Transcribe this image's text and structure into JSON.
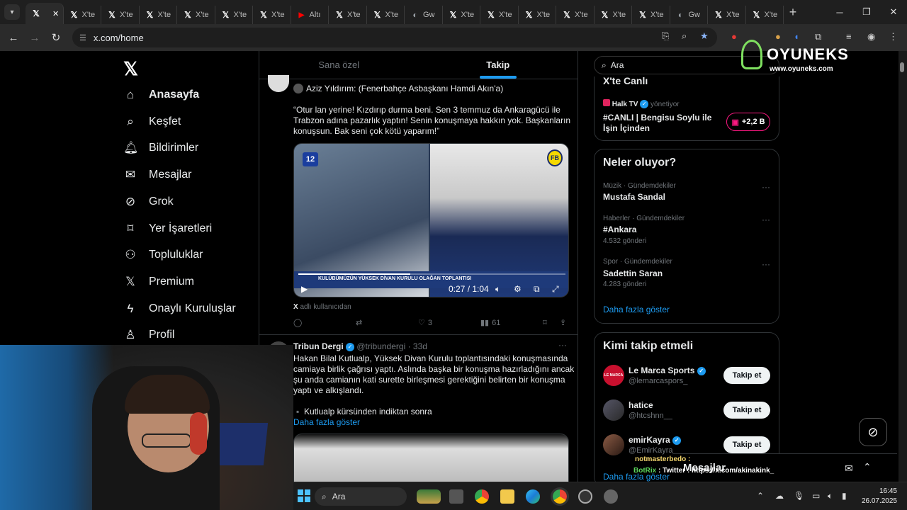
{
  "browser": {
    "tabs": [
      {
        "icon": "X",
        "label": ""
      },
      {
        "icon": "X",
        "label": "X'te"
      },
      {
        "icon": "X",
        "label": "X'te"
      },
      {
        "icon": "X",
        "label": "X'te"
      },
      {
        "icon": "X",
        "label": "X'te"
      },
      {
        "icon": "X",
        "label": "X'te"
      },
      {
        "icon": "X",
        "label": "X'te"
      },
      {
        "icon": "YT",
        "label": "Altı"
      },
      {
        "icon": "X",
        "label": "X'te"
      },
      {
        "icon": "X",
        "label": "X'te"
      },
      {
        "icon": "G",
        "label": "Gw"
      },
      {
        "icon": "X",
        "label": "X'te"
      },
      {
        "icon": "X",
        "label": "X'te"
      },
      {
        "icon": "X",
        "label": "X'te"
      },
      {
        "icon": "X",
        "label": "X'te"
      },
      {
        "icon": "X",
        "label": "X'te"
      },
      {
        "icon": "X",
        "label": "X'te"
      },
      {
        "icon": "G",
        "label": "Gw"
      },
      {
        "icon": "X",
        "label": "X'te"
      },
      {
        "icon": "X",
        "label": "X'te"
      }
    ],
    "url": "x.com/home"
  },
  "nav": {
    "items": [
      {
        "label": "Anasayfa",
        "icon": "home-icon"
      },
      {
        "label": "Keşfet",
        "icon": "search-icon"
      },
      {
        "label": "Bildirimler",
        "icon": "bell-icon"
      },
      {
        "label": "Mesajlar",
        "icon": "mail-icon"
      },
      {
        "label": "Grok",
        "icon": "grok-icon"
      },
      {
        "label": "Yer İşaretleri",
        "icon": "bookmark-icon"
      },
      {
        "label": "Topluluklar",
        "icon": "people-icon"
      },
      {
        "label": "Premium",
        "icon": "x-icon"
      },
      {
        "label": "Onaylı Kuruluşlar",
        "icon": "bolt-icon"
      },
      {
        "label": "Profil",
        "icon": "person-icon"
      }
    ]
  },
  "feed": {
    "tabs": [
      "Sana özel",
      "Takip"
    ],
    "post1": {
      "quote_author": "Aziz Yıldırım: (Fenerbahçe Asbaşkanı Hamdi Akın'a)",
      "lines": [
        "“Otur lan yerine! Kızdırıp durma beni. Sen 3 temmuz da Ankaragücü ile",
        "Trabzon adına pazarlık yaptın! Senin konuşmaya hakkın yok. Başkanların",
        "konuşsun. Bak seni çok kötü yaparım!”"
      ],
      "video": {
        "channel_badge": "12",
        "banner": "KULÜBÜMÜZÜN YÜKSEK DİVAN KURULU OLAĞAN TOPLANTISI",
        "time": "0:27 / 1:04",
        "progress": 0.42
      },
      "source_note": "adlı kullanıcıdan",
      "source_mark": "X",
      "stats": {
        "likes": "3",
        "views": "61"
      }
    },
    "post2": {
      "author": "Tribun Dergi",
      "handle": "@tribundergi · 33d",
      "lines": [
        "Hakan Bilal Kutlualp, Yüksek Divan Kurulu toplantısındaki konuşmasında",
        "camiaya birlik çağrısı yaptı. Aslında başka bir konuşma hazırladığını ancak",
        "şu anda camianın kati surette birleşmesi gerektiğini belirten bir konuşma",
        "yaptı ve alkışlandı."
      ],
      "bullet": "Kutlualp kürsünden indiktan sonra",
      "show_more": "Daha fazla göster"
    }
  },
  "right": {
    "search_placeholder": "Ara",
    "live": {
      "title": "X'te Canlı",
      "host": "Halk TV",
      "host_role": "yönetiyor",
      "stream_title_1": "#CANLI | Bengisu Soylu ile",
      "stream_title_2": "İşin İçinden",
      "listeners": "+2,2 B"
    },
    "trends": {
      "title": "Neler oluyor?",
      "items": [
        {
          "cat": "Müzik · Gündemdekiler",
          "name": "Mustafa Sandal",
          "count": ""
        },
        {
          "cat": "Haberler · Gündemdekiler",
          "name": "#Ankara",
          "count": "4.532 gönderi"
        },
        {
          "cat": "Spor · Gündemdekiler",
          "name": "Sadettin Saran",
          "count": "4.283 gönderi"
        }
      ],
      "more": "Daha fazla göster"
    },
    "wtf": {
      "title": "Kimi takip etmeli",
      "items": [
        {
          "name": "Le Marca Sports",
          "handle": "@lemarcaspors_",
          "verified": true,
          "avatar_text": "LE MARCA"
        },
        {
          "name": "hatice",
          "handle": "@htcshnn__",
          "verified": false,
          "avatar_text": ""
        },
        {
          "name": "emirKayra",
          "handle": "@EmirKayra_",
          "verified": true,
          "avatar_text": ""
        }
      ],
      "follow_label": "Takip et",
      "more": "Daha fazla göster"
    },
    "messages_label": "Mesajlar"
  },
  "overlay": {
    "watermark": "OYUNEKS",
    "watermark_url": "www.oyuneks.com",
    "chat_user": "notmasterbedo :",
    "chat_bot": "BotRix",
    "chat_bot_msg": ": Twitter : https://x.com/akinakink_"
  },
  "taskbar": {
    "search": "Ara",
    "time": "16:45",
    "date": "26.07.2025"
  },
  "colors": {
    "accent": "#1d9bf0",
    "live": "#f91880"
  }
}
